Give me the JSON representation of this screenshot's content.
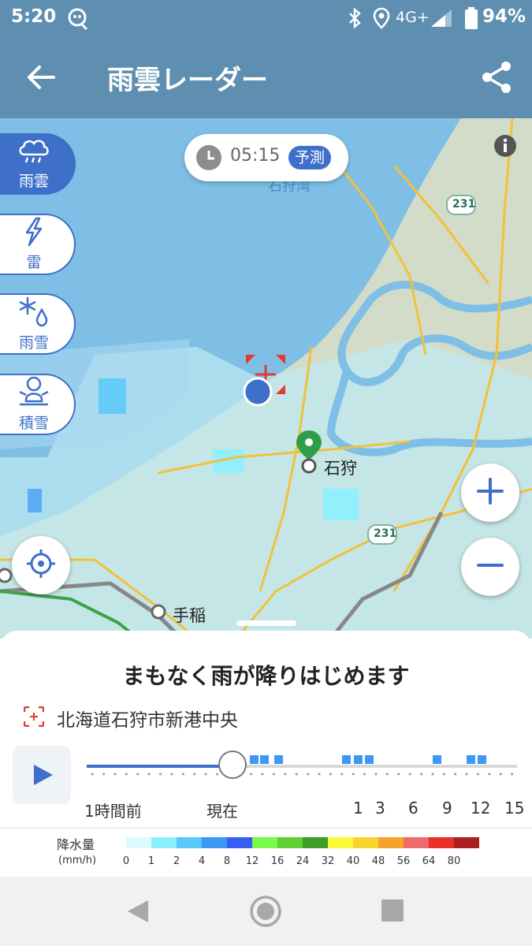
{
  "status_bar": {
    "time": "5:20",
    "network": "4G+",
    "battery": "94%"
  },
  "app_bar": {
    "title": "雨雲レーダー"
  },
  "map": {
    "time_chip": "05:15",
    "forecast_badge": "予測",
    "bay_label": "石狩湾",
    "road_number_top": "231",
    "road_number_bottom": "231",
    "place_ishikari": "石狩",
    "place_teine": "手稲"
  },
  "layers": [
    {
      "label": "雨雲",
      "icon": "cloud-rain-icon"
    },
    {
      "label": "雷",
      "icon": "lightning-icon"
    },
    {
      "label": "雨雪",
      "icon": "snow-rain-icon"
    },
    {
      "label": "積雪",
      "icon": "snowman-icon"
    }
  ],
  "sheet": {
    "headline": "まもなく雨が降りはじめます",
    "location": "北海道石狩市新港中央",
    "timeline_ticks": [
      "1時間前",
      "現在",
      "1",
      "3",
      "6",
      "9",
      "12",
      "15"
    ],
    "timeline_position": 0.33
  },
  "legend": {
    "title": "降水量",
    "unit": "(mm/h)",
    "values": [
      "0",
      "1",
      "2",
      "4",
      "8",
      "12",
      "16",
      "24",
      "32",
      "40",
      "48",
      "56",
      "64",
      "80"
    ],
    "colors": [
      "#d9fbff",
      "#8cf1ff",
      "#59c8f8",
      "#3b98f3",
      "#3a5cf0",
      "#7af84b",
      "#5fcf34",
      "#3e9d2b",
      "#fbf93a",
      "#f9d42f",
      "#f6a22d",
      "#ef6a6a",
      "#e93128",
      "#a9201e"
    ]
  },
  "colors": {
    "header": "#5e8fb0",
    "accent": "#3e6fc9",
    "sea": "#7fbfe6",
    "land": "#cdd9c4"
  }
}
